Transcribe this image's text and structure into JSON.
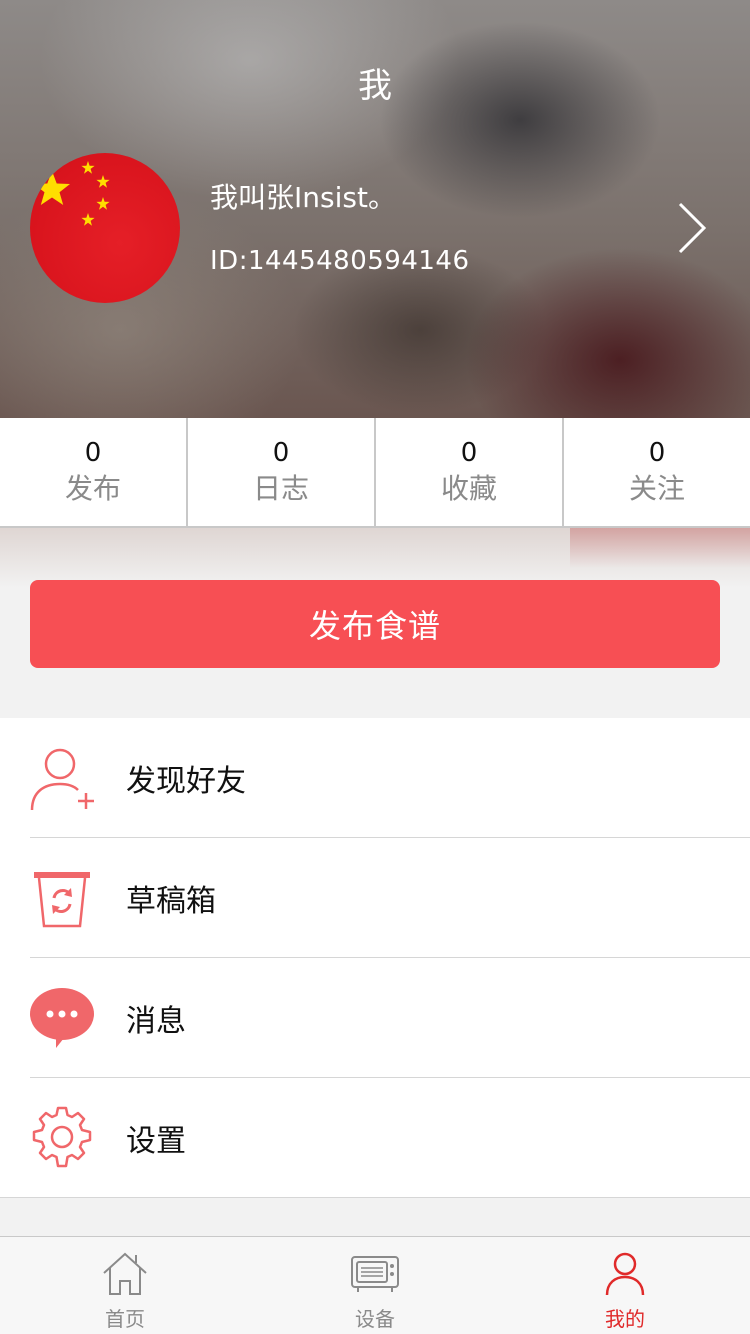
{
  "header": {
    "title": "我",
    "user_name": "我叫张Insist。",
    "user_id": "ID:1445480594146"
  },
  "stats": [
    {
      "value": "0",
      "label": "发布"
    },
    {
      "value": "0",
      "label": "日志"
    },
    {
      "value": "0",
      "label": "收藏"
    },
    {
      "value": "0",
      "label": "关注"
    }
  ],
  "publish_button": "发布食谱",
  "menu": [
    {
      "label": "发现好友",
      "icon": "add-user-icon"
    },
    {
      "label": "草稿箱",
      "icon": "drafts-box-icon"
    },
    {
      "label": "消息",
      "icon": "message-bubble-icon"
    },
    {
      "label": "设置",
      "icon": "gear-icon"
    }
  ],
  "tabbar": [
    {
      "label": "首页",
      "icon": "home-icon",
      "active": false
    },
    {
      "label": "设备",
      "icon": "oven-icon",
      "active": false
    },
    {
      "label": "我的",
      "icon": "person-icon",
      "active": true
    }
  ],
  "colors": {
    "accent": "#f74f54",
    "active_tab": "#e02a2a",
    "inactive_tab": "#8a8a8a",
    "flag_red": "#de2910",
    "flag_star": "#ffde00"
  }
}
